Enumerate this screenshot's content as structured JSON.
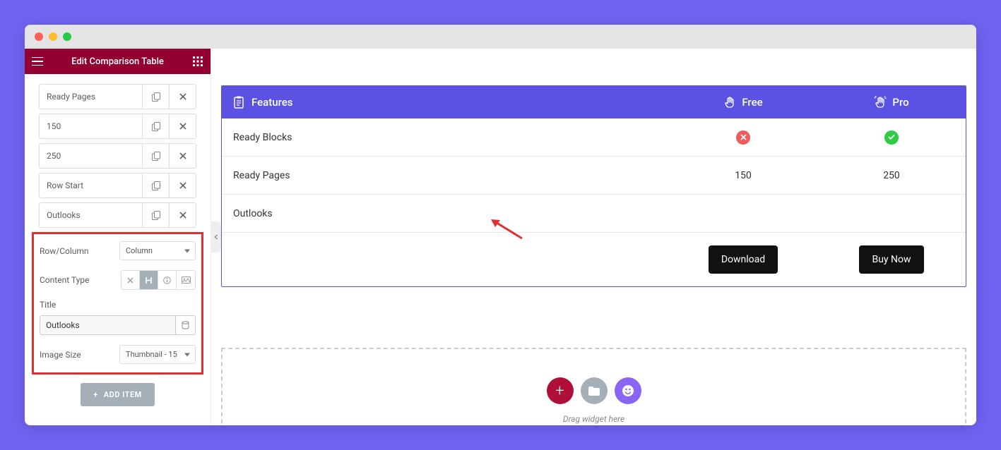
{
  "sidebar": {
    "title": "Edit Comparison Table",
    "items": [
      {
        "label": "Ready Pages"
      },
      {
        "label": "150"
      },
      {
        "label": "250"
      },
      {
        "label": "Row Start"
      },
      {
        "label": "Outlooks"
      }
    ],
    "fields": {
      "row_column_label": "Row/Column",
      "row_column_value": "Column",
      "content_type_label": "Content Type",
      "title_label": "Title",
      "title_value": "Outlooks",
      "image_size_label": "Image Size",
      "image_size_value": "Thumbnail - 15"
    },
    "add_item_label": "ADD ITEM"
  },
  "table": {
    "header": {
      "features": "Features",
      "col1": "Free",
      "col2": "Pro"
    },
    "rows": [
      {
        "feature": "Ready Blocks",
        "col1_icon": "x",
        "col2_icon": "check"
      },
      {
        "feature": "Ready Pages",
        "col1_text": "150",
        "col2_text": "250"
      },
      {
        "feature": "Outlooks"
      }
    ],
    "buttons": {
      "col1": "Download",
      "col2": "Buy Now"
    }
  },
  "dropzone": {
    "text": "Drag widget here"
  }
}
